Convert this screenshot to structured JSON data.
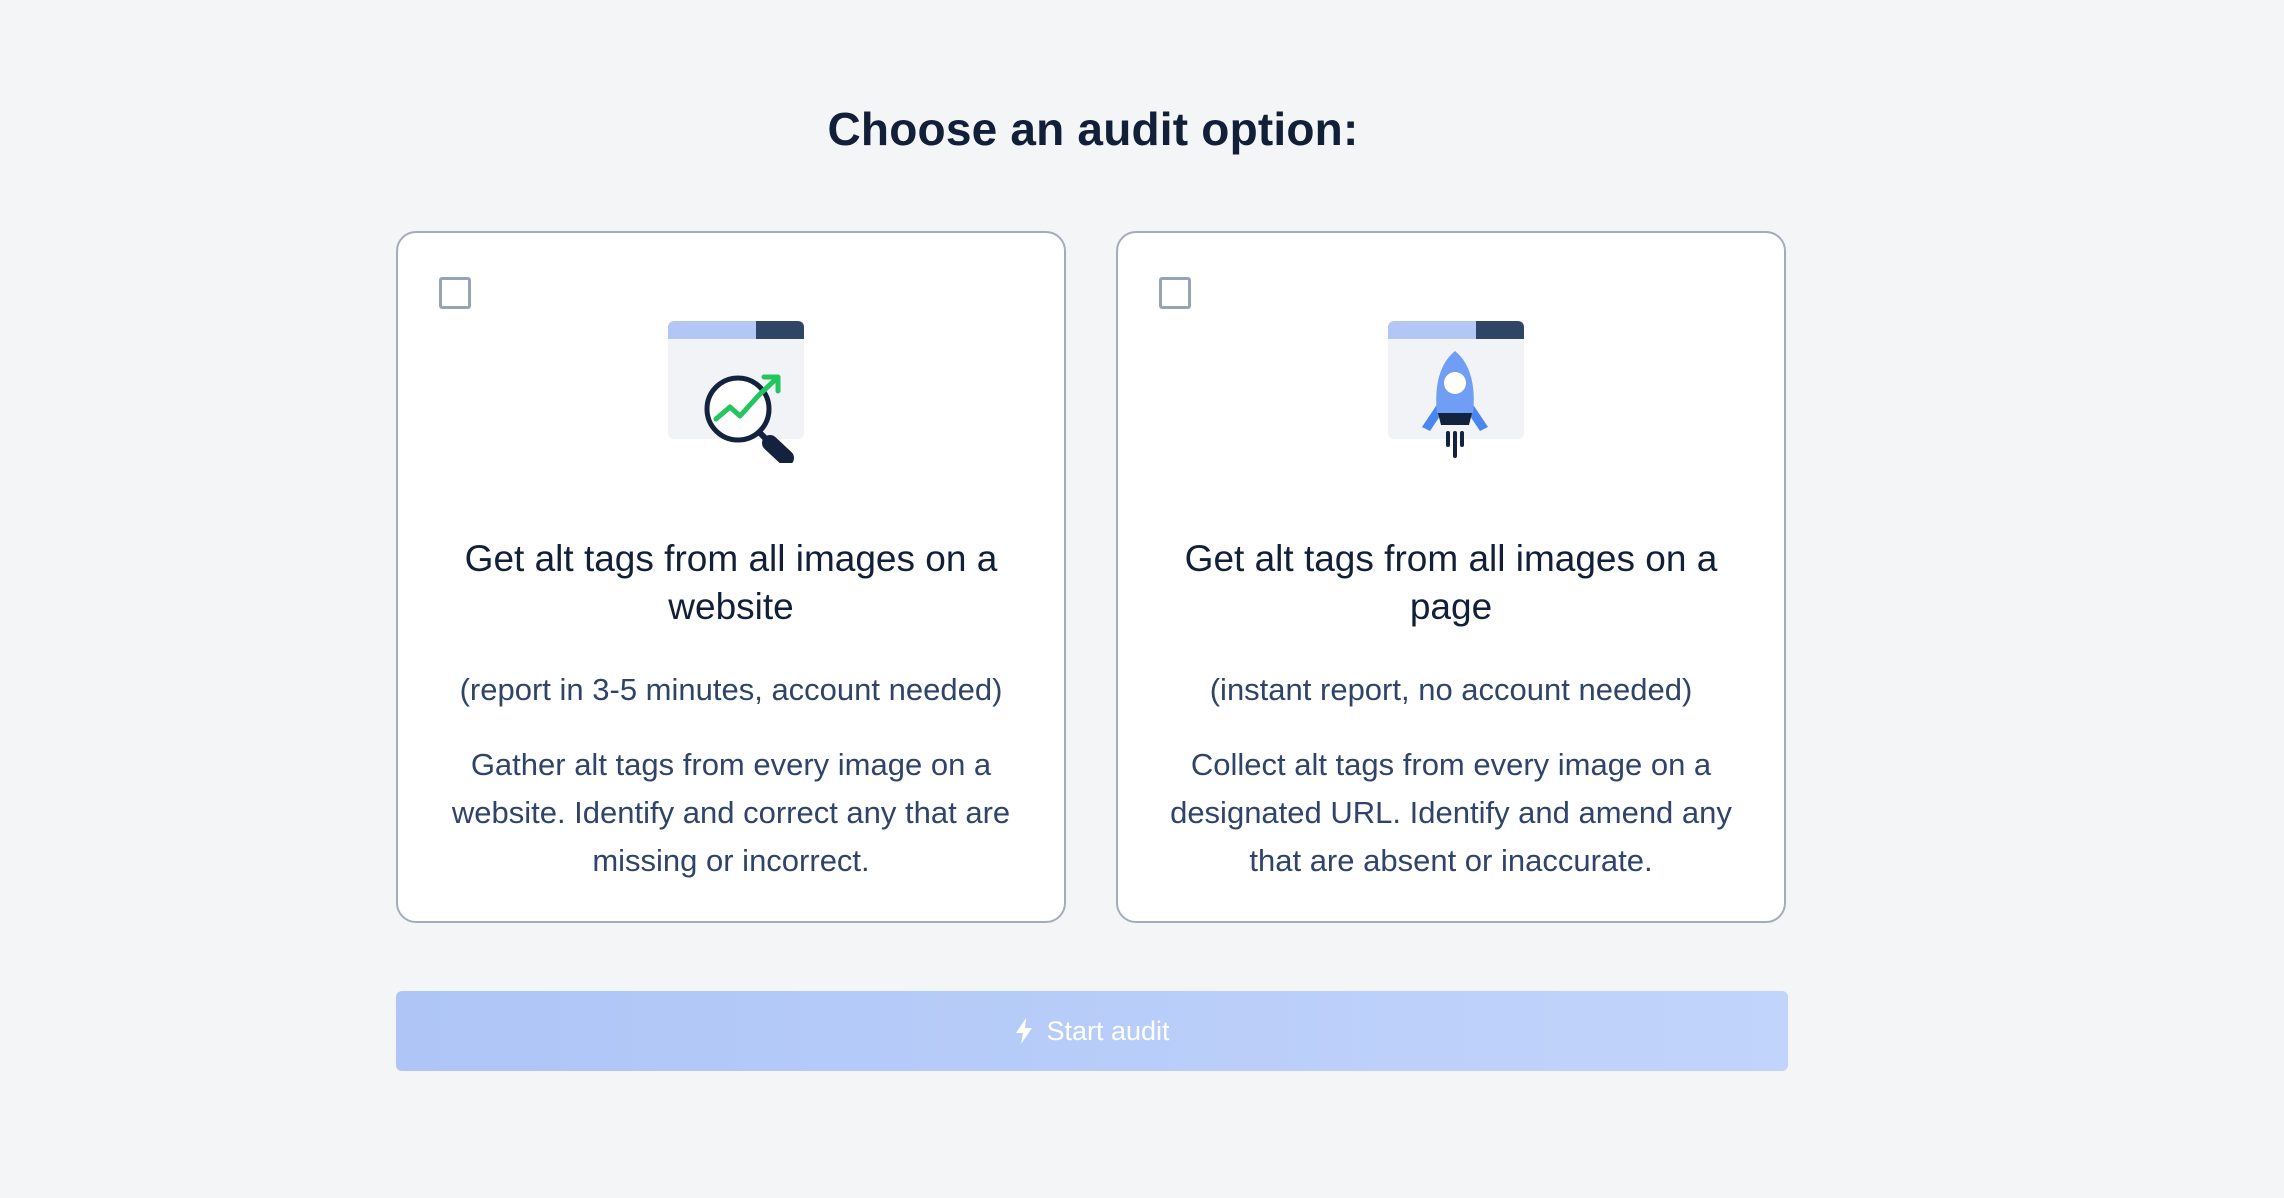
{
  "page": {
    "title": "Choose an audit option:"
  },
  "options": [
    {
      "title": "Get alt tags from all images on a website",
      "subtitle": "(report in 3-5 minutes, account needed)",
      "description": "Gather alt tags from every image on a website. Identify and correct any that are missing or incorrect.",
      "icon": "magnifier-growth-chart-icon",
      "checked": false
    },
    {
      "title": "Get alt tags from all images on a page",
      "subtitle": "(instant report, no account needed)",
      "description": "Collect alt tags from every image on a designated URL. Identify and amend any that are absent or inaccurate.",
      "icon": "rocket-launch-icon",
      "checked": false
    }
  ],
  "start_button": {
    "label": "Start audit",
    "icon": "lightning-bolt-icon"
  },
  "colors": {
    "background": "#f4f5f7",
    "heading": "#111f38",
    "body_text": "#2f4468",
    "card_border": "#a3acbd",
    "button_start": "#aec5f6",
    "button_end": "#c1d4fb",
    "chart_green": "#22c55e",
    "window_bar": "#b3c7f7",
    "window_bar_dark": "#2f4566"
  }
}
